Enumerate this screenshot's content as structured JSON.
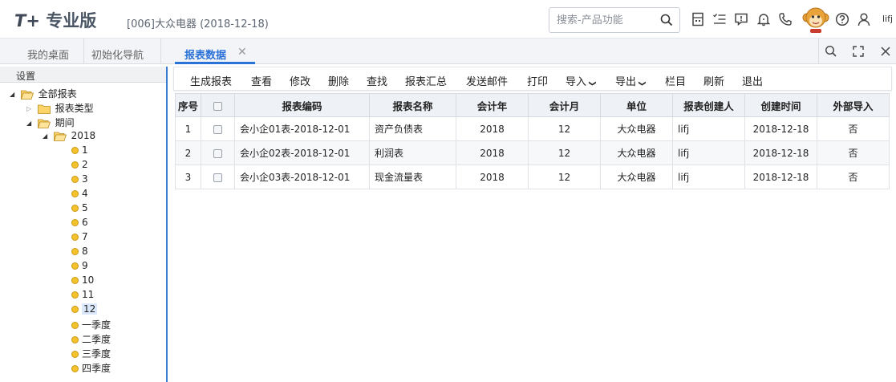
{
  "header": {
    "logo_prefix": "T+",
    "logo_text": "专业版",
    "company": "[006]大众电器   (2018-12-18)",
    "search_placeholder": "搜索-产品功能",
    "user_name": "lifj"
  },
  "tabs": {
    "desktop": "我的桌面",
    "init_nav": "初始化导航",
    "report_data": "报表数据",
    "close_glyph": "✕"
  },
  "left_panel": {
    "title": "设置",
    "root": "全部报表",
    "report_type": "报表类型",
    "period": "期间",
    "year": "2018",
    "months": [
      "1",
      "2",
      "3",
      "4",
      "5",
      "6",
      "7",
      "8",
      "9",
      "10",
      "11",
      "12"
    ],
    "quarters": [
      "一季度",
      "二季度",
      "三季度",
      "四季度"
    ],
    "selected": "12"
  },
  "toolbar": {
    "generate": "生成报表",
    "view": "查看",
    "modify": "修改",
    "delete": "删除",
    "find": "查找",
    "summary": "报表汇总",
    "email": "发送邮件",
    "print": "打印",
    "import": "导入",
    "export": "导出",
    "columns": "栏目",
    "refresh": "刷新",
    "exit": "退出"
  },
  "table": {
    "headers": {
      "seq": "序号",
      "code": "报表编码",
      "name": "报表名称",
      "year": "会计年",
      "month": "会计月",
      "unit": "单位",
      "creator": "报表创建人",
      "created": "创建时间",
      "external": "外部导入"
    },
    "rows": [
      {
        "seq": "1",
        "code": "会小企01表-2018-12-01",
        "name": "资产负债表",
        "year": "2018",
        "month": "12",
        "unit": "大众电器",
        "creator": "lifj",
        "created": "2018-12-18",
        "external": "否"
      },
      {
        "seq": "2",
        "code": "会小企02表-2018-12-01",
        "name": "利润表",
        "year": "2018",
        "month": "12",
        "unit": "大众电器",
        "creator": "lifj",
        "created": "2018-12-18",
        "external": "否"
      },
      {
        "seq": "3",
        "code": "会小企03表-2018-12-01",
        "name": "现金流量表",
        "year": "2018",
        "month": "12",
        "unit": "大众电器",
        "creator": "lifj",
        "created": "2018-12-18",
        "external": "否"
      }
    ]
  },
  "colors": {
    "accent": "#2a71d8",
    "folder": "#f3c22c",
    "header_bg": "#eef1f5"
  }
}
